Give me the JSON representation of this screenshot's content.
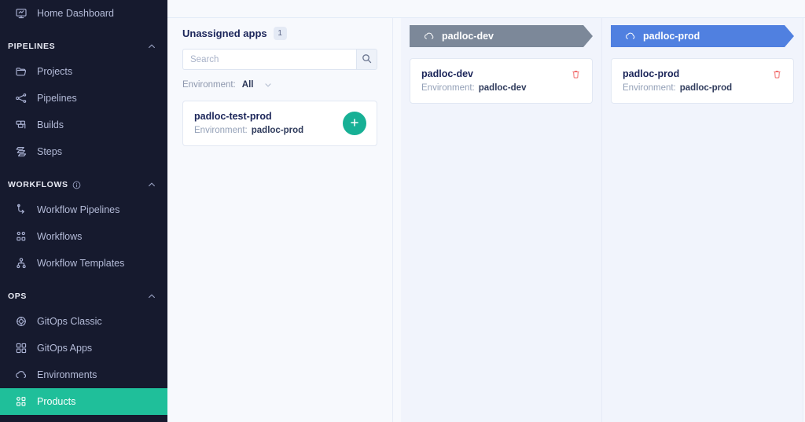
{
  "sidebar": {
    "top_items": [
      {
        "label": "Home Dashboard",
        "icon": "home-dashboard-icon",
        "active": false
      }
    ],
    "sections": [
      {
        "title": "PIPELINES",
        "has_info": false,
        "collapse_icon": "chevron-up-icon",
        "items": [
          {
            "label": "Projects",
            "icon": "folder-icon",
            "active": false
          },
          {
            "label": "Pipelines",
            "icon": "pipelines-icon",
            "active": false
          },
          {
            "label": "Builds",
            "icon": "builds-icon",
            "active": false
          },
          {
            "label": "Steps",
            "icon": "steps-icon",
            "active": false
          }
        ]
      },
      {
        "title": "WORKFLOWS",
        "has_info": true,
        "info_icon": "info-circle-icon",
        "collapse_icon": "chevron-up-icon",
        "items": [
          {
            "label": "Workflow Pipelines",
            "icon": "workflow-pipelines-icon",
            "active": false
          },
          {
            "label": "Workflows",
            "icon": "workflows-icon",
            "active": false
          },
          {
            "label": "Workflow Templates",
            "icon": "workflow-templates-icon",
            "active": false
          }
        ]
      },
      {
        "title": "OPS",
        "has_info": false,
        "collapse_icon": "chevron-up-icon",
        "items": [
          {
            "label": "GitOps Classic",
            "icon": "gitops-classic-icon",
            "active": false
          },
          {
            "label": "GitOps Apps",
            "icon": "gitops-apps-icon",
            "active": false
          },
          {
            "label": "Environments",
            "icon": "cloud-icon",
            "active": false
          },
          {
            "label": "Products",
            "icon": "products-icon",
            "active": true
          }
        ]
      }
    ]
  },
  "unassigned": {
    "title": "Unassigned apps",
    "count": "1",
    "search": {
      "value": "",
      "placeholder": "Search",
      "icon": "search-icon"
    },
    "filter": {
      "label": "Environment:",
      "value": "All",
      "icon": "chevron-down-icon"
    },
    "cards": [
      {
        "title": "padloc-test-prod",
        "meta_label": "Environment:",
        "meta_value": "padloc-prod",
        "action_icon": "plus-icon"
      }
    ]
  },
  "columns": [
    {
      "name": "padloc-dev",
      "icon": "cloud-icon",
      "color": "#7c8899",
      "cards": [
        {
          "title": "padloc-dev",
          "meta_label": "Environment:",
          "meta_value": "padloc-dev",
          "action_icon": "trash-icon"
        }
      ]
    },
    {
      "name": "padloc-prod",
      "icon": "cloud-icon",
      "color": "#5080e0",
      "cards": [
        {
          "title": "padloc-prod",
          "meta_label": "Environment:",
          "meta_value": "padloc-prod",
          "action_icon": "trash-icon"
        }
      ]
    }
  ],
  "theme": {
    "sidebar_bg": "#161a2e",
    "active_item_bg": "#1fbf9a",
    "add_button_bg": "#17b095",
    "trash_color": "#f16d6d",
    "app_bg": "#f7f9fd",
    "column_bg": "#f1f4fc"
  }
}
